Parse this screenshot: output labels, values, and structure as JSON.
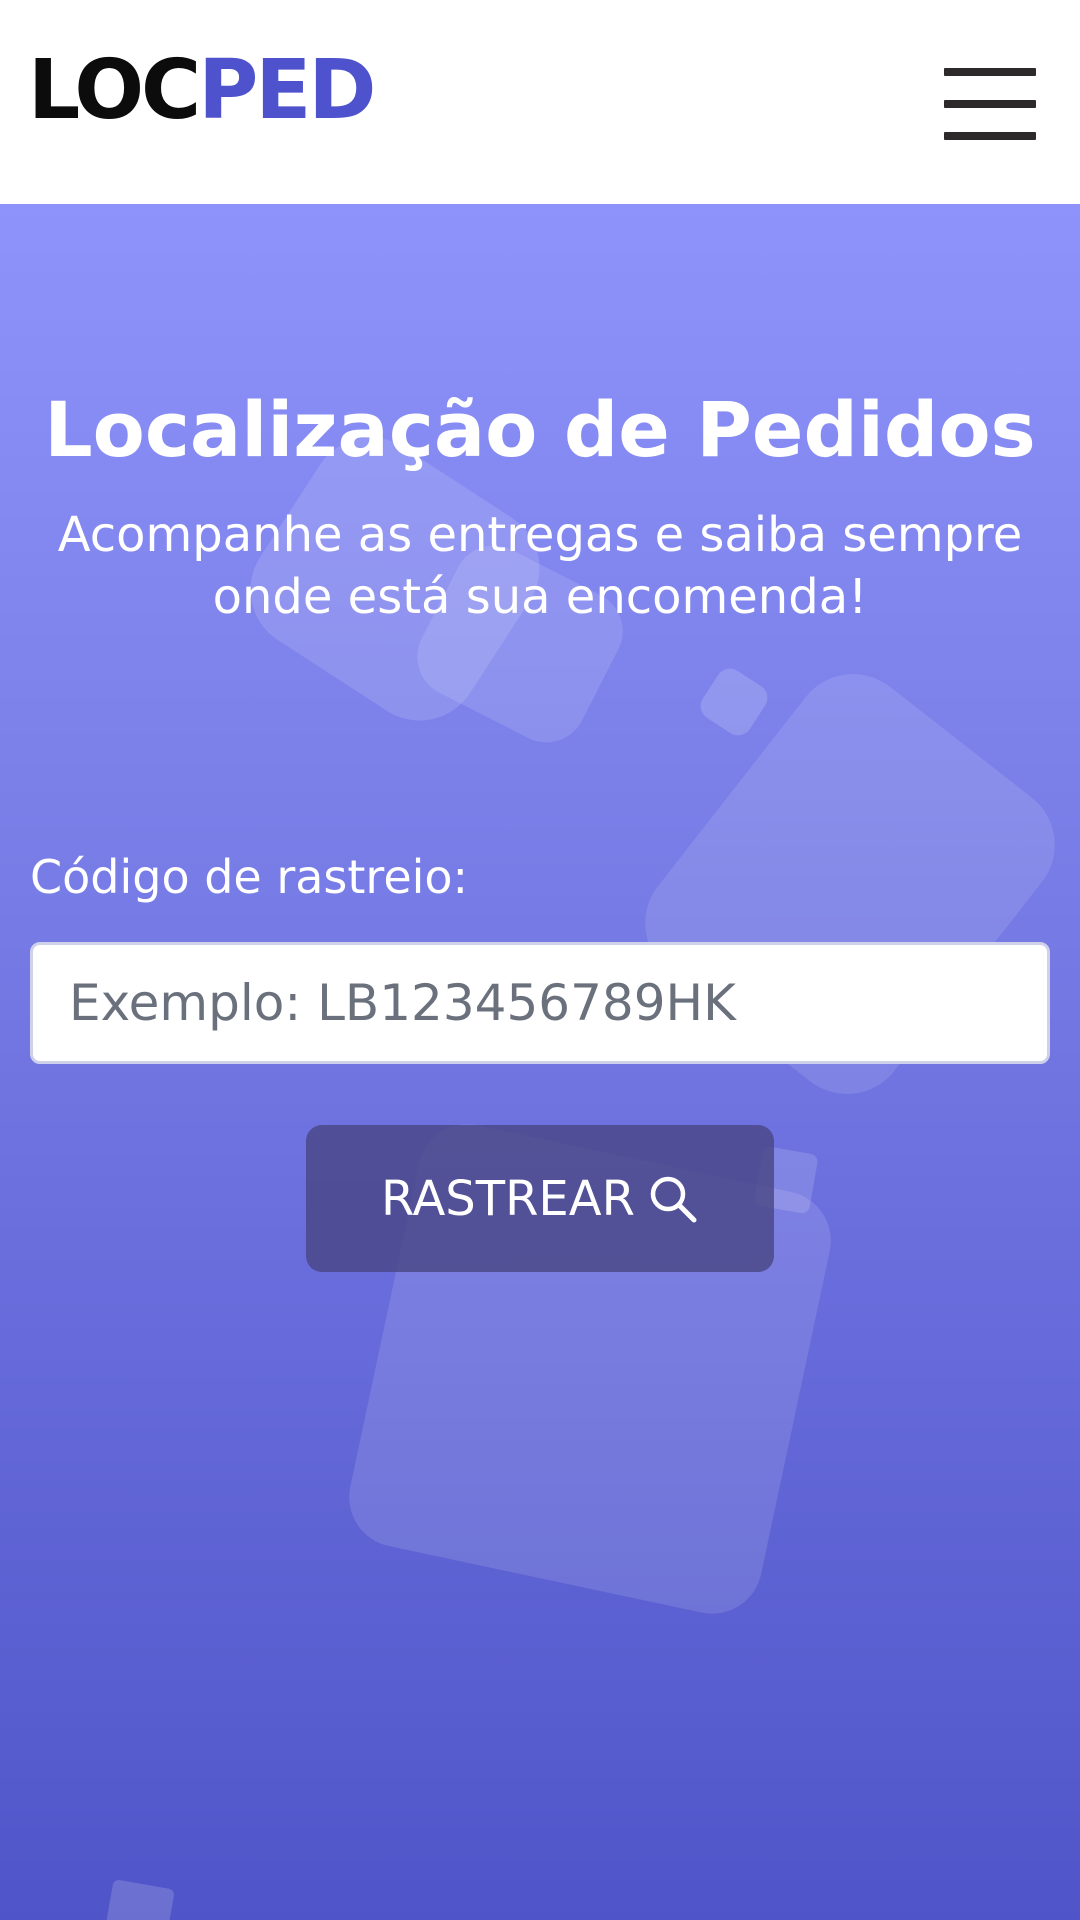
{
  "header": {
    "logo_part1": "LOC",
    "logo_part2": "PED",
    "logo_colors": {
      "part1": "#0c0c0c",
      "part2": "#4e52cc"
    },
    "menu_icon": "hamburger-menu-icon"
  },
  "hero": {
    "title": "Localização de Pedidos",
    "subtitle": "Acompanhe as entregas e saiba sempre onde está sua encomenda!",
    "gradient_colors": [
      "#8d93fa",
      "#4f55c8"
    ]
  },
  "tracking": {
    "label": "Código de rastreio:",
    "placeholder": "Exemplo: LB123456789HK",
    "value": "",
    "button_label": "RASTREAR",
    "button_icon": "search-icon"
  }
}
